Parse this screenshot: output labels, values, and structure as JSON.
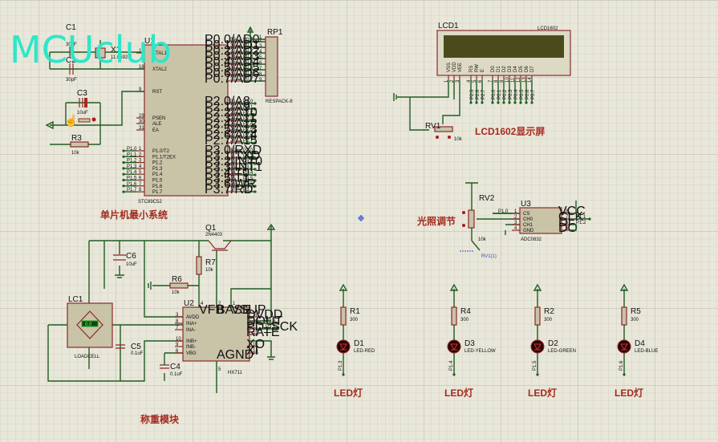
{
  "logo": "MCUclub",
  "colors": {
    "background": "#e8e7da",
    "wire": "#1f5d1f",
    "component_outline": "#8b2a2a",
    "component_fill": "#c9c3a8",
    "title_text": "#a52a1e",
    "logo": "#2ee6c8",
    "lcd_screen": "#4b4a1c",
    "net_probe": "#3a4bd0"
  },
  "mcu": {
    "ref": "U1",
    "part": "STC89C52",
    "title": "单片机最小系统",
    "left_pins": [
      {
        "num": "19",
        "name": "XTAL1"
      },
      {
        "num": "18",
        "name": "XTAL2"
      },
      {
        "num": "9",
        "name": "RST"
      },
      {
        "num": "29",
        "name": "PSEN"
      },
      {
        "num": "30",
        "name": "ALE"
      },
      {
        "num": "31",
        "name": "EA"
      }
    ],
    "p0": [
      {
        "num": "39",
        "name": "P0.0/AD0",
        "net": "P0.0"
      },
      {
        "num": "38",
        "name": "P0.1/AD1",
        "net": "P0.1"
      },
      {
        "num": "37",
        "name": "P0.2/AD2",
        "net": "P0.2"
      },
      {
        "num": "36",
        "name": "P0.3/AD3",
        "net": "P0.3"
      },
      {
        "num": "35",
        "name": "P0.4/AD4",
        "net": "P0.4"
      },
      {
        "num": "34",
        "name": "P0.5/AD5",
        "net": "P0.5"
      },
      {
        "num": "33",
        "name": "P0.6/AD6",
        "net": "P0.6"
      },
      {
        "num": "32",
        "name": "P0.7/AD7",
        "net": "P0.7"
      }
    ],
    "p2": [
      {
        "num": "21",
        "name": "P2.0/A8",
        "net": "P2.0"
      },
      {
        "num": "22",
        "name": "P2.1/A9",
        "net": "P2.1"
      },
      {
        "num": "23",
        "name": "P2.2/A10",
        "net": "P2.2"
      },
      {
        "num": "24",
        "name": "P2.3/A11",
        "net": "P2.3"
      },
      {
        "num": "25",
        "name": "P2.4/A12",
        "net": "P2.4"
      },
      {
        "num": "26",
        "name": "P2.5/A13",
        "net": "P2.5"
      },
      {
        "num": "27",
        "name": "P2.6/A14",
        "net": "P2.6"
      },
      {
        "num": "28",
        "name": "P2.7/A15",
        "net": "P2.7"
      }
    ],
    "p3": [
      {
        "num": "10",
        "name": "P3.0/RXD",
        "net": "P3.0"
      },
      {
        "num": "11",
        "name": "P3.1/TXD",
        "net": "P3.1"
      },
      {
        "num": "12",
        "name": "P3.2/INT0",
        "net": "P3.2"
      },
      {
        "num": "13",
        "name": "P3.3/INT1",
        "net": "P3.3"
      },
      {
        "num": "14",
        "name": "P3.4/T0",
        "net": "P3.4"
      },
      {
        "num": "15",
        "name": "P3.5/T1",
        "net": "P3.5"
      },
      {
        "num": "16",
        "name": "P3.6/WR",
        "net": "P3.6"
      },
      {
        "num": "17",
        "name": "P3.7/RD",
        "net": "P3.7"
      }
    ],
    "p1": [
      {
        "num": "1",
        "name": "P1.0/T2",
        "net": "P1.0"
      },
      {
        "num": "2",
        "name": "P1.1/T2EX",
        "net": "P1.1"
      },
      {
        "num": "3",
        "name": "P1.2",
        "net": "P1.2"
      },
      {
        "num": "4",
        "name": "P1.3",
        "net": "P1.3"
      },
      {
        "num": "5",
        "name": "P1.4",
        "net": "P1.4"
      },
      {
        "num": "6",
        "name": "P1.5",
        "net": "P1.5"
      },
      {
        "num": "7",
        "name": "P1.6",
        "net": "P1.6"
      },
      {
        "num": "8",
        "name": "P1.7",
        "net": "P1.7"
      }
    ]
  },
  "rp1": {
    "ref": "RP1",
    "part": "RESPACK-8",
    "pins": [
      "1",
      "2",
      "3",
      "4",
      "5",
      "6",
      "7",
      "8",
      "9"
    ]
  },
  "c1": {
    "ref": "C1",
    "value": "30pF"
  },
  "c2": {
    "ref": "C2",
    "value": "30pF"
  },
  "x1": {
    "ref": "X1",
    "value": "11.0592M"
  },
  "c3": {
    "ref": "C3",
    "value": "10uF"
  },
  "r3": {
    "ref": "R3",
    "value": "10k"
  },
  "lcd": {
    "ref": "LCD1",
    "part": "LCD1602",
    "title": "LCD1602显示屏",
    "pins": [
      {
        "num": "1",
        "name": "VSS",
        "net": ""
      },
      {
        "num": "2",
        "name": "VDD",
        "net": ""
      },
      {
        "num": "3",
        "name": "VEE",
        "net": ""
      },
      {
        "num": "4",
        "name": "RS",
        "net": "P2.5"
      },
      {
        "num": "5",
        "name": "RW",
        "net": "P2.6"
      },
      {
        "num": "6",
        "name": "E",
        "net": "P2.7"
      },
      {
        "num": "7",
        "name": "D0",
        "net": "P0.0"
      },
      {
        "num": "8",
        "name": "D1",
        "net": "P0.1"
      },
      {
        "num": "9",
        "name": "D2",
        "net": "P0.2"
      },
      {
        "num": "10",
        "name": "D3",
        "net": "P0.3"
      },
      {
        "num": "11",
        "name": "D4",
        "net": "P0.4"
      },
      {
        "num": "12",
        "name": "D5",
        "net": "P0.5"
      },
      {
        "num": "13",
        "name": "D6",
        "net": "P0.6"
      },
      {
        "num": "14",
        "name": "D7",
        "net": "P0.7"
      }
    ]
  },
  "rv1": {
    "ref": "RV1",
    "value": "10k"
  },
  "adc": {
    "ref": "U3",
    "part": "ADC0832",
    "title": "光照调节",
    "left": [
      {
        "num": "1",
        "name": "CS",
        "net": "P1.0"
      },
      {
        "num": "2",
        "name": "CH0"
      },
      {
        "num": "3",
        "name": "CH1"
      },
      {
        "num": "4",
        "name": "GND"
      }
    ],
    "right": [
      {
        "num": "8",
        "name": "VCC"
      },
      {
        "num": "7",
        "name": "CLK",
        "net": "P1.1"
      },
      {
        "num": "6",
        "name": "DI",
        "net": "P1.2"
      },
      {
        "num": "5",
        "name": "DO"
      }
    ]
  },
  "rv2": {
    "ref": "RV2",
    "value": "10k",
    "probe": "RV1(1)"
  },
  "leds": [
    {
      "r_ref": "R1",
      "r_val": "300",
      "d_ref": "D1",
      "d_part": "LED-RED",
      "net": "P1.3",
      "title": "LED灯"
    },
    {
      "r_ref": "R4",
      "r_val": "300",
      "d_ref": "D3",
      "d_part": "LED-YELLOW",
      "net": "P1.4",
      "title": "LED灯"
    },
    {
      "r_ref": "R2",
      "r_val": "300",
      "d_ref": "D2",
      "d_part": "LED-GREEN",
      "net": "P1.5",
      "title": "LED灯"
    },
    {
      "r_ref": "R5",
      "r_val": "300",
      "d_ref": "D4",
      "d_part": "LED-BLUE",
      "net": "P1.6",
      "title": "LED灯"
    }
  ],
  "weigh": {
    "title": "称重模块",
    "q1": {
      "ref": "Q1",
      "part": "2N4403"
    },
    "r7": {
      "ref": "R7",
      "value": "10k"
    },
    "r6": {
      "ref": "R6",
      "value": "10k"
    },
    "c6": {
      "ref": "C6",
      "value": "10uF"
    },
    "c5": {
      "ref": "C5",
      "value": "0.1uF"
    },
    "c4": {
      "ref": "C4",
      "value": "0.1uF"
    },
    "lc1": {
      "ref": "LC1",
      "part": "LOADCELL",
      "display": "0.0"
    },
    "u2": {
      "ref": "U2",
      "part": "HX711",
      "top": [
        {
          "num": "4",
          "name": "VFB"
        },
        {
          "num": "2",
          "name": "BASE"
        },
        {
          "num": "1",
          "name": "VSUP"
        }
      ],
      "left": [
        {
          "num": "3",
          "name": "AVDD"
        },
        {
          "num": "8",
          "name": "INA+"
        },
        {
          "num": "7",
          "name": "INA-"
        },
        {
          "num": "10",
          "name": "INB+"
        },
        {
          "num": "9",
          "name": "INB-"
        },
        {
          "num": "6",
          "name": "VBG"
        }
      ],
      "right": [
        {
          "num": "16",
          "name": "DVDD"
        },
        {
          "num": "12",
          "name": "DOUT",
          "net": "P3.6"
        },
        {
          "num": "11",
          "name": "PD_SCK",
          "net": "P3.7"
        },
        {
          "num": "15",
          "name": "RATE"
        },
        {
          "num": "13",
          "name": "XO"
        },
        {
          "num": "14",
          "name": "XI"
        }
      ],
      "bottom": [
        {
          "num": "5",
          "name": "AGND"
        }
      ]
    }
  }
}
